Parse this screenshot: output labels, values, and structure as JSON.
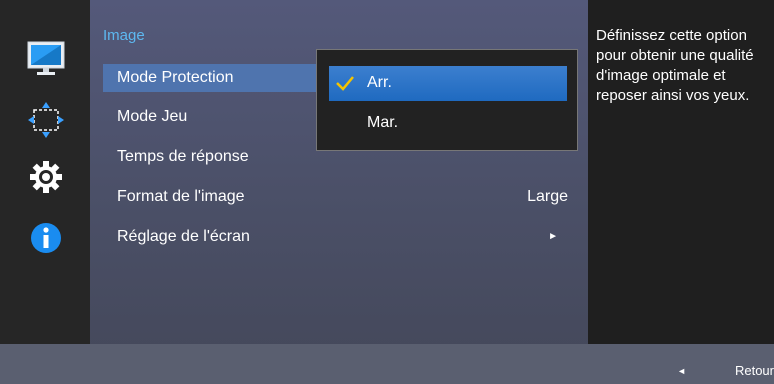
{
  "menu": {
    "title": "Image",
    "items": [
      {
        "label": "Mode Protection",
        "value": "",
        "arrow": ""
      },
      {
        "label": "Mode Jeu",
        "value": "",
        "arrow": ""
      },
      {
        "label": "Temps de réponse",
        "value": "",
        "arrow": ""
      },
      {
        "label": "Format de l'image",
        "value": "Large",
        "arrow": ""
      },
      {
        "label": "Réglage de l'écran",
        "value": "",
        "arrow": "►"
      }
    ]
  },
  "popup": {
    "options": [
      {
        "label": "Arr.",
        "selected": true
      },
      {
        "label": "Mar.",
        "selected": false
      }
    ]
  },
  "help": {
    "text": "Définissez cette option pour obtenir une qualité d'image optimale et reposer ainsi vos yeux."
  },
  "footer": {
    "back_label": "Retour"
  },
  "icons": [
    "monitor-icon",
    "resize-icon",
    "gear-icon",
    "info-icon"
  ],
  "colors": {
    "accent": "#5db8f0",
    "selection": "#1f6ac0",
    "active_row": "#4f74ae"
  }
}
